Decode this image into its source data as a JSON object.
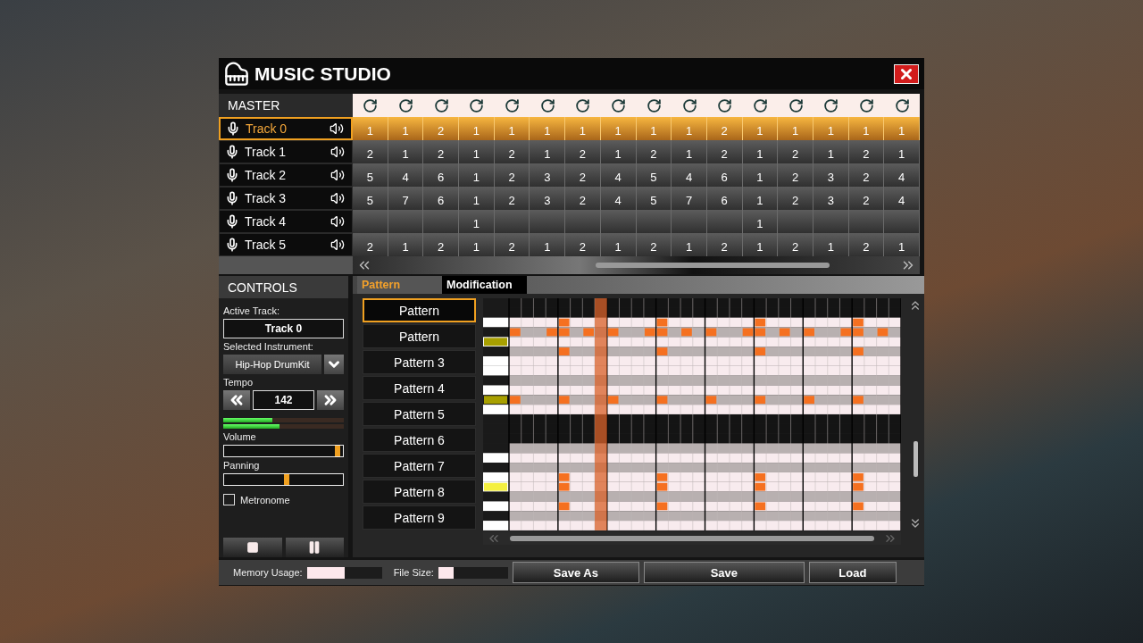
{
  "window": {
    "title": "MUSIC STUDIO"
  },
  "master": {
    "label": "MASTER"
  },
  "tracks": [
    {
      "name": "Track 0",
      "selected": true,
      "cells": [
        "1",
        "1",
        "2",
        "1",
        "1",
        "1",
        "1",
        "1",
        "1",
        "1",
        "2",
        "1",
        "1",
        "1",
        "1",
        "1"
      ]
    },
    {
      "name": "Track 1",
      "selected": false,
      "cells": [
        "2",
        "1",
        "2",
        "1",
        "2",
        "1",
        "2",
        "1",
        "2",
        "1",
        "2",
        "1",
        "2",
        "1",
        "2",
        "1"
      ]
    },
    {
      "name": "Track 2",
      "selected": false,
      "cells": [
        "5",
        "4",
        "6",
        "1",
        "2",
        "3",
        "2",
        "4",
        "5",
        "4",
        "6",
        "1",
        "2",
        "3",
        "2",
        "4"
      ]
    },
    {
      "name": "Track 3",
      "selected": false,
      "cells": [
        "5",
        "7",
        "6",
        "1",
        "2",
        "3",
        "2",
        "4",
        "5",
        "7",
        "6",
        "1",
        "2",
        "3",
        "2",
        "4"
      ]
    },
    {
      "name": "Track 4",
      "selected": false,
      "cells": [
        null,
        null,
        null,
        "1",
        null,
        null,
        null,
        null,
        null,
        null,
        null,
        "1",
        null,
        null,
        null,
        null
      ]
    },
    {
      "name": "Track 5",
      "selected": false,
      "cells": [
        "2",
        "1",
        "2",
        "1",
        "2",
        "1",
        "2",
        "1",
        "2",
        "1",
        "2",
        "1",
        "2",
        "1",
        "2",
        "1"
      ]
    }
  ],
  "controls": {
    "title": "CONTROLS",
    "active_track_label": "Active Track:",
    "active_track": "Track 0",
    "instrument_label": "Selected Instrument:",
    "instrument": "Hip-Hop DrumKit",
    "tempo_label": "Tempo",
    "tempo": "142",
    "meters": [
      {
        "level": 0.41
      },
      {
        "level": 0.47
      }
    ],
    "volume": {
      "label": "Volume",
      "level": 0.98
    },
    "panning": {
      "label": "Panning",
      "level": 0.53
    },
    "metronome": {
      "label": "Metronome",
      "checked": false
    }
  },
  "editor_tabs": [
    {
      "label": "Pattern",
      "selected": true
    },
    {
      "label": "Modification",
      "selected": false
    }
  ],
  "patterns": [
    {
      "label": "Pattern",
      "selected": true
    },
    {
      "label": "Pattern",
      "selected": false
    },
    {
      "label": "Pattern 3",
      "selected": false
    },
    {
      "label": "Pattern 4",
      "selected": false
    },
    {
      "label": "Pattern 5",
      "selected": false
    },
    {
      "label": "Pattern 6",
      "selected": false
    },
    {
      "label": "Pattern 7",
      "selected": false
    },
    {
      "label": "Pattern 8",
      "selected": false
    },
    {
      "label": "Pattern 9",
      "selected": false
    }
  ],
  "status_bar": {
    "memory": {
      "label": "Memory Usage:",
      "level": 0.5
    },
    "file_size": {
      "label": "File Size:",
      "level": 0.22
    }
  },
  "buttons": [
    "Save As",
    "Save",
    "Load"
  ]
}
